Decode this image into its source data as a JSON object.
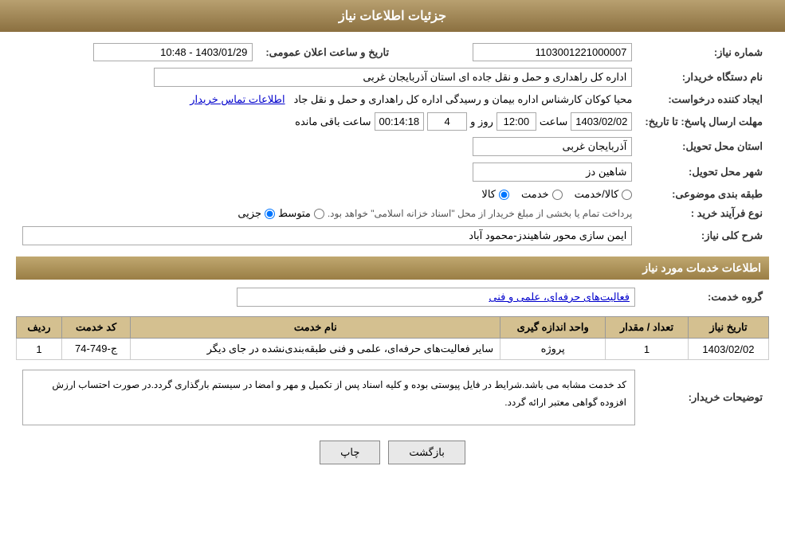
{
  "header": {
    "title": "جزئیات اطلاعات نیاز"
  },
  "fields": {
    "shomareNiaz_label": "شماره نیاز:",
    "shomareNiaz_value": "1103001221000007",
    "namDastgah_label": "نام دستگاه خریدار:",
    "namDastgah_value": "اداره کل راهداری و حمل و نقل جاده ای استان آذربایجان غربی",
    "ijaadKonandeLabel": "ایجاد کننده درخواست:",
    "ijaadKonandeLink": "اطلاعات تماس خریدار",
    "ijaadKonandeText": "محیا کوکان کارشناس اداره بیمان و رسیدگی اداره کل راهداری و حمل و نقل جاد",
    "mohlat_label": "مهلت ارسال پاسخ: تا تاریخ:",
    "mohlat_date": "1403/02/02",
    "mohlat_time_label": "ساعت",
    "mohlat_time": "12:00",
    "mohlat_roz_label": "روز و",
    "mohlat_roz": "4",
    "mohlat_baghimande_label": "ساعت باقی مانده",
    "mohlat_baghimande": "00:14:18",
    "tarikh_label": "تاریخ و ساعت اعلان عمومی:",
    "tarikh_value": "1403/01/29 - 10:48",
    "ostan_label": "استان محل تحویل:",
    "ostan_value": "آذربایجان غربی",
    "shahr_label": "شهر محل تحویل:",
    "shahr_value": "شاهین دز",
    "tabaghe_label": "طبقه بندی موضوعی:",
    "radio_kala": "کالا",
    "radio_khedmat": "خدمت",
    "radio_kala_khedmat": "کالا/خدمت",
    "noeFarayand_label": "نوع فرآیند خرید :",
    "radio_jozii": "جزیی",
    "radio_motavasset": "متوسط",
    "farayand_text": "پرداخت تمام یا بخشی از مبلغ خریدار از محل \"اسناد خزانه اسلامی\" خواهد بود.",
    "sharh_label": "شرح کلی نیاز:",
    "sharh_value": "ایمن سازی محور شاهیندز-محمود آباد",
    "section2_title": "اطلاعات خدمات مورد نیاز",
    "groheKhedmat_label": "گروه خدمت:",
    "groheKhedmat_value": "فعالیت‌های حرفه‌ای، علمی و فنی",
    "table": {
      "col_radif": "ردیف",
      "col_code": "کد خدمت",
      "col_name": "نام خدمت",
      "col_unit": "واحد اندازه گیری",
      "col_count": "تعداد / مقدار",
      "col_date": "تاریخ نیاز",
      "rows": [
        {
          "radif": "1",
          "code": "ج-749-74",
          "name": "سایر فعالیت‌های حرفه‌ای، علمی و فنی طبقه‌بندی‌نشده در جای دیگر",
          "unit": "پروژه",
          "count": "1",
          "date": "1403/02/02"
        }
      ]
    },
    "toozihat_label": "توضیحات خریدار:",
    "toozihat_value": "کد خدمت مشابه می باشد.شرایط در فایل پیوستی بوده و کلیه اسناد پس از تکمیل و مهر و امضا در سیستم بارگذاری گردد.در صورت احتساب ارزش افزوده گواهی معتبر ارائه گردد.",
    "btn_chap": "چاپ",
    "btn_bazgasht": "بازگشت"
  }
}
